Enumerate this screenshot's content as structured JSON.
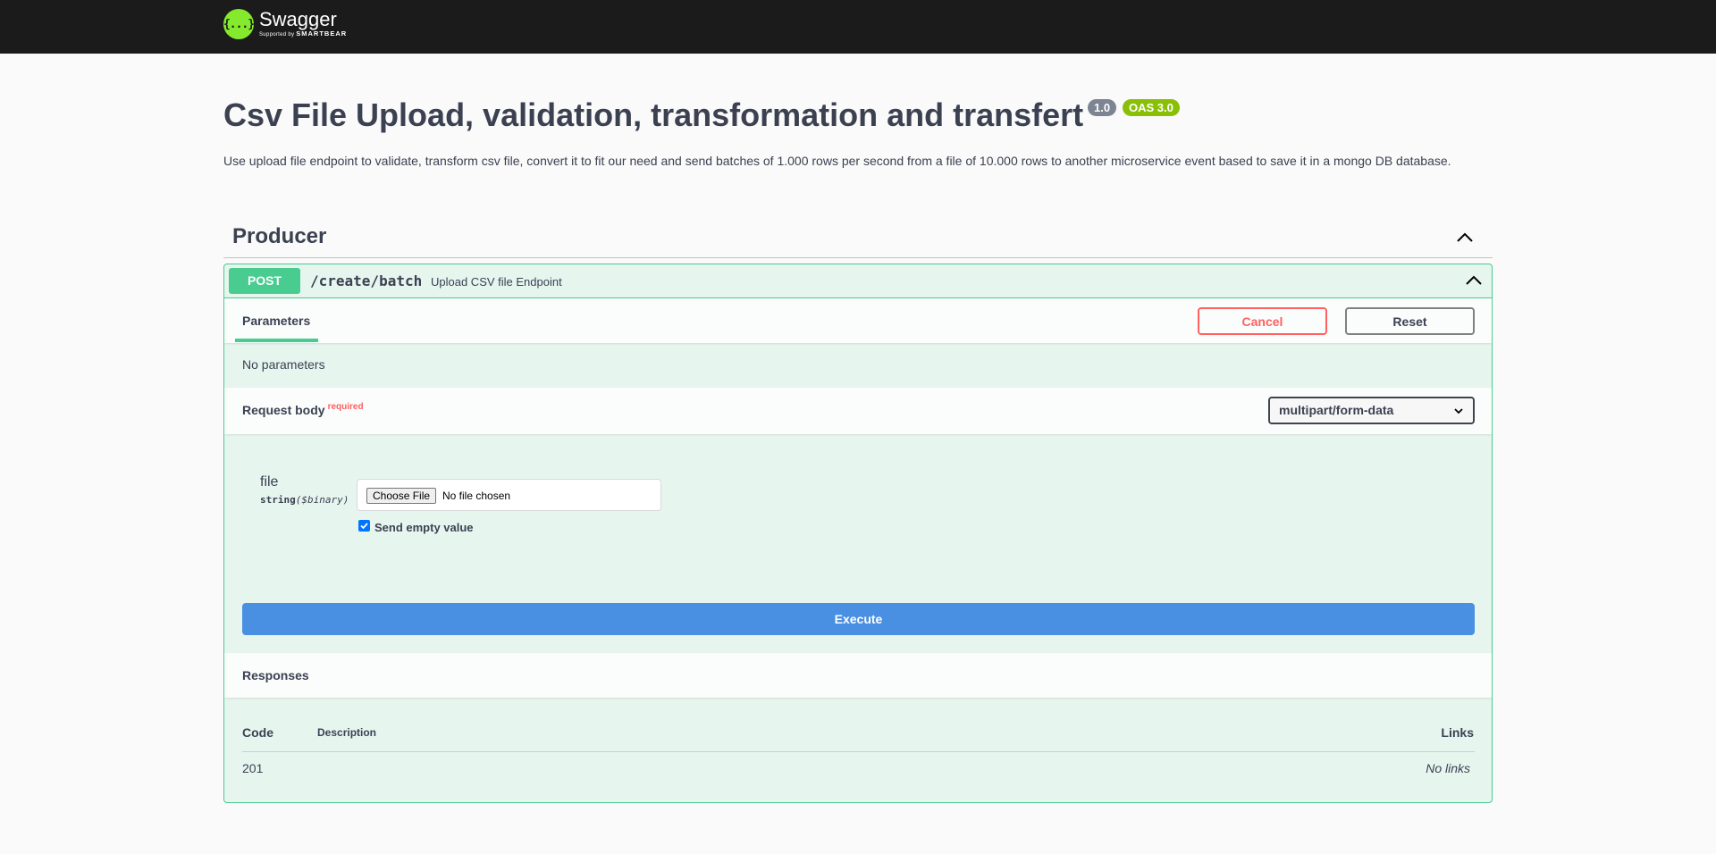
{
  "topbar": {
    "logo_glyph": "{...}",
    "logo_title": "Swagger",
    "logo_sub_prefix": "Supported by",
    "logo_sub_brand": "SMARTBEAR"
  },
  "info": {
    "title": "Csv File Upload, validation, transformation and transfert",
    "version": "1.0",
    "oas": "OAS 3.0",
    "description": "Use upload file endpoint to validate, transform csv file, convert it to fit our need and send batches of 1.000 rows per second from a file of 10.000 rows to another microservice event based to save it in a mongo DB database."
  },
  "tag": {
    "name": "Producer"
  },
  "operation": {
    "method": "POST",
    "path": "/create/batch",
    "summary": "Upload CSV file Endpoint",
    "tab_parameters": "Parameters",
    "cancel_label": "Cancel",
    "reset_label": "Reset",
    "no_parameters": "No parameters",
    "request_body_label": "Request body",
    "required_label": "required",
    "content_type": "multipart/form-data",
    "param_name": "file",
    "param_type": "string",
    "param_format": "($binary)",
    "choose_file_label": "Choose File",
    "no_file_label": "No file chosen",
    "send_empty_label": "Send empty value",
    "send_empty_checked": true,
    "execute_label": "Execute",
    "responses_label": "Responses",
    "responses_columns": {
      "code": "Code",
      "description": "Description",
      "links": "Links"
    },
    "responses": [
      {
        "code": "201",
        "description": "",
        "links": "No links"
      }
    ]
  },
  "colors": {
    "post": "#49cc90",
    "execute": "#4990e2",
    "cancel": "#ff6060",
    "topbar": "#1b1b1b",
    "logo": "#85ea2d",
    "badge_version": "#7d8492",
    "badge_oas": "#89bf04"
  }
}
